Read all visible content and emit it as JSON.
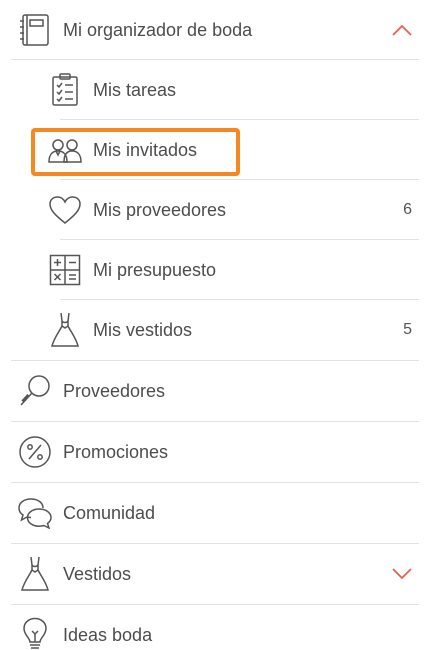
{
  "menu": {
    "organizer": {
      "label": "Mi organizador de boda",
      "icon": "planner-book-icon",
      "expanded": true,
      "items": [
        {
          "label": "Mis tareas",
          "icon": "clipboard-checklist-icon",
          "count": ""
        },
        {
          "label": "Mis invitados",
          "icon": "guests-couple-icon",
          "count": ""
        },
        {
          "label": "Mis proveedores",
          "icon": "heart-icon",
          "count": "6"
        },
        {
          "label": "Mi presupuesto",
          "icon": "calculator-icon",
          "count": ""
        },
        {
          "label": "Mis vestidos",
          "icon": "dress-icon",
          "count": "5"
        }
      ]
    },
    "items": [
      {
        "label": "Proveedores",
        "icon": "magnifier-icon"
      },
      {
        "label": "Promociones",
        "icon": "percent-badge-icon"
      },
      {
        "label": "Comunidad",
        "icon": "chat-bubbles-icon"
      },
      {
        "label": "Vestidos",
        "icon": "dress-icon",
        "collapsed": true
      },
      {
        "label": "Ideas boda",
        "icon": "lightbulb-icon"
      }
    ]
  },
  "colors": {
    "accent": "#e8604c",
    "highlight": "#f5891f",
    "icon": "#555555",
    "text": "#4d4d4d",
    "divider": "#e3e3e3"
  }
}
